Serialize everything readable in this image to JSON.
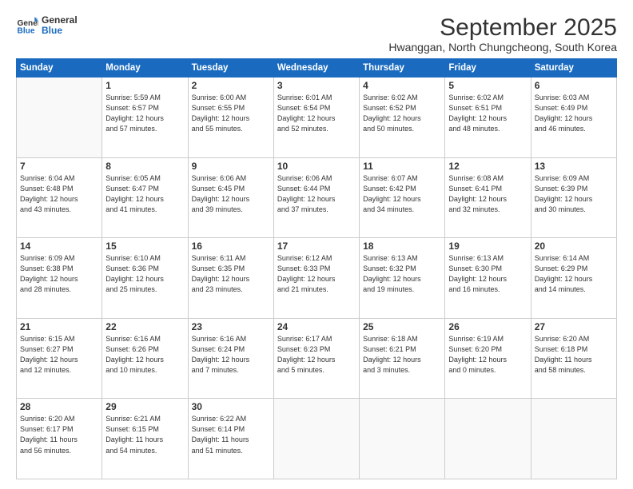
{
  "logo": {
    "line1": "General",
    "line2": "Blue"
  },
  "title": "September 2025",
  "subtitle": "Hwanggan, North Chungcheong, South Korea",
  "weekdays": [
    "Sunday",
    "Monday",
    "Tuesday",
    "Wednesday",
    "Thursday",
    "Friday",
    "Saturday"
  ],
  "weeks": [
    [
      {
        "day": "",
        "content": ""
      },
      {
        "day": "1",
        "content": "Sunrise: 5:59 AM\nSunset: 6:57 PM\nDaylight: 12 hours\nand 57 minutes."
      },
      {
        "day": "2",
        "content": "Sunrise: 6:00 AM\nSunset: 6:55 PM\nDaylight: 12 hours\nand 55 minutes."
      },
      {
        "day": "3",
        "content": "Sunrise: 6:01 AM\nSunset: 6:54 PM\nDaylight: 12 hours\nand 52 minutes."
      },
      {
        "day": "4",
        "content": "Sunrise: 6:02 AM\nSunset: 6:52 PM\nDaylight: 12 hours\nand 50 minutes."
      },
      {
        "day": "5",
        "content": "Sunrise: 6:02 AM\nSunset: 6:51 PM\nDaylight: 12 hours\nand 48 minutes."
      },
      {
        "day": "6",
        "content": "Sunrise: 6:03 AM\nSunset: 6:49 PM\nDaylight: 12 hours\nand 46 minutes."
      }
    ],
    [
      {
        "day": "7",
        "content": "Sunrise: 6:04 AM\nSunset: 6:48 PM\nDaylight: 12 hours\nand 43 minutes."
      },
      {
        "day": "8",
        "content": "Sunrise: 6:05 AM\nSunset: 6:47 PM\nDaylight: 12 hours\nand 41 minutes."
      },
      {
        "day": "9",
        "content": "Sunrise: 6:06 AM\nSunset: 6:45 PM\nDaylight: 12 hours\nand 39 minutes."
      },
      {
        "day": "10",
        "content": "Sunrise: 6:06 AM\nSunset: 6:44 PM\nDaylight: 12 hours\nand 37 minutes."
      },
      {
        "day": "11",
        "content": "Sunrise: 6:07 AM\nSunset: 6:42 PM\nDaylight: 12 hours\nand 34 minutes."
      },
      {
        "day": "12",
        "content": "Sunrise: 6:08 AM\nSunset: 6:41 PM\nDaylight: 12 hours\nand 32 minutes."
      },
      {
        "day": "13",
        "content": "Sunrise: 6:09 AM\nSunset: 6:39 PM\nDaylight: 12 hours\nand 30 minutes."
      }
    ],
    [
      {
        "day": "14",
        "content": "Sunrise: 6:09 AM\nSunset: 6:38 PM\nDaylight: 12 hours\nand 28 minutes."
      },
      {
        "day": "15",
        "content": "Sunrise: 6:10 AM\nSunset: 6:36 PM\nDaylight: 12 hours\nand 25 minutes."
      },
      {
        "day": "16",
        "content": "Sunrise: 6:11 AM\nSunset: 6:35 PM\nDaylight: 12 hours\nand 23 minutes."
      },
      {
        "day": "17",
        "content": "Sunrise: 6:12 AM\nSunset: 6:33 PM\nDaylight: 12 hours\nand 21 minutes."
      },
      {
        "day": "18",
        "content": "Sunrise: 6:13 AM\nSunset: 6:32 PM\nDaylight: 12 hours\nand 19 minutes."
      },
      {
        "day": "19",
        "content": "Sunrise: 6:13 AM\nSunset: 6:30 PM\nDaylight: 12 hours\nand 16 minutes."
      },
      {
        "day": "20",
        "content": "Sunrise: 6:14 AM\nSunset: 6:29 PM\nDaylight: 12 hours\nand 14 minutes."
      }
    ],
    [
      {
        "day": "21",
        "content": "Sunrise: 6:15 AM\nSunset: 6:27 PM\nDaylight: 12 hours\nand 12 minutes."
      },
      {
        "day": "22",
        "content": "Sunrise: 6:16 AM\nSunset: 6:26 PM\nDaylight: 12 hours\nand 10 minutes."
      },
      {
        "day": "23",
        "content": "Sunrise: 6:16 AM\nSunset: 6:24 PM\nDaylight: 12 hours\nand 7 minutes."
      },
      {
        "day": "24",
        "content": "Sunrise: 6:17 AM\nSunset: 6:23 PM\nDaylight: 12 hours\nand 5 minutes."
      },
      {
        "day": "25",
        "content": "Sunrise: 6:18 AM\nSunset: 6:21 PM\nDaylight: 12 hours\nand 3 minutes."
      },
      {
        "day": "26",
        "content": "Sunrise: 6:19 AM\nSunset: 6:20 PM\nDaylight: 12 hours\nand 0 minutes."
      },
      {
        "day": "27",
        "content": "Sunrise: 6:20 AM\nSunset: 6:18 PM\nDaylight: 11 hours\nand 58 minutes."
      }
    ],
    [
      {
        "day": "28",
        "content": "Sunrise: 6:20 AM\nSunset: 6:17 PM\nDaylight: 11 hours\nand 56 minutes."
      },
      {
        "day": "29",
        "content": "Sunrise: 6:21 AM\nSunset: 6:15 PM\nDaylight: 11 hours\nand 54 minutes."
      },
      {
        "day": "30",
        "content": "Sunrise: 6:22 AM\nSunset: 6:14 PM\nDaylight: 11 hours\nand 51 minutes."
      },
      {
        "day": "",
        "content": ""
      },
      {
        "day": "",
        "content": ""
      },
      {
        "day": "",
        "content": ""
      },
      {
        "day": "",
        "content": ""
      }
    ]
  ]
}
